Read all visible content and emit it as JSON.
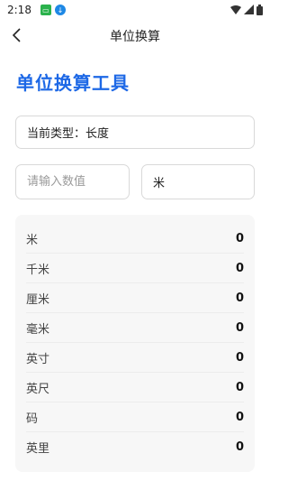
{
  "status_bar": {
    "time": "2:18"
  },
  "top_bar": {
    "title": "单位换算"
  },
  "heading": "单位换算工具",
  "type_box": {
    "label": "当前类型：长度"
  },
  "value_input": {
    "placeholder": "请输入数值",
    "value": ""
  },
  "unit_select": {
    "selected": "米"
  },
  "results": [
    {
      "unit": "米",
      "value": "0"
    },
    {
      "unit": "千米",
      "value": "0"
    },
    {
      "unit": "厘米",
      "value": "0"
    },
    {
      "unit": "毫米",
      "value": "0"
    },
    {
      "unit": "英寸",
      "value": "0"
    },
    {
      "unit": "英尺",
      "value": "0"
    },
    {
      "unit": "码",
      "value": "0"
    },
    {
      "unit": "英里",
      "value": "0"
    }
  ]
}
